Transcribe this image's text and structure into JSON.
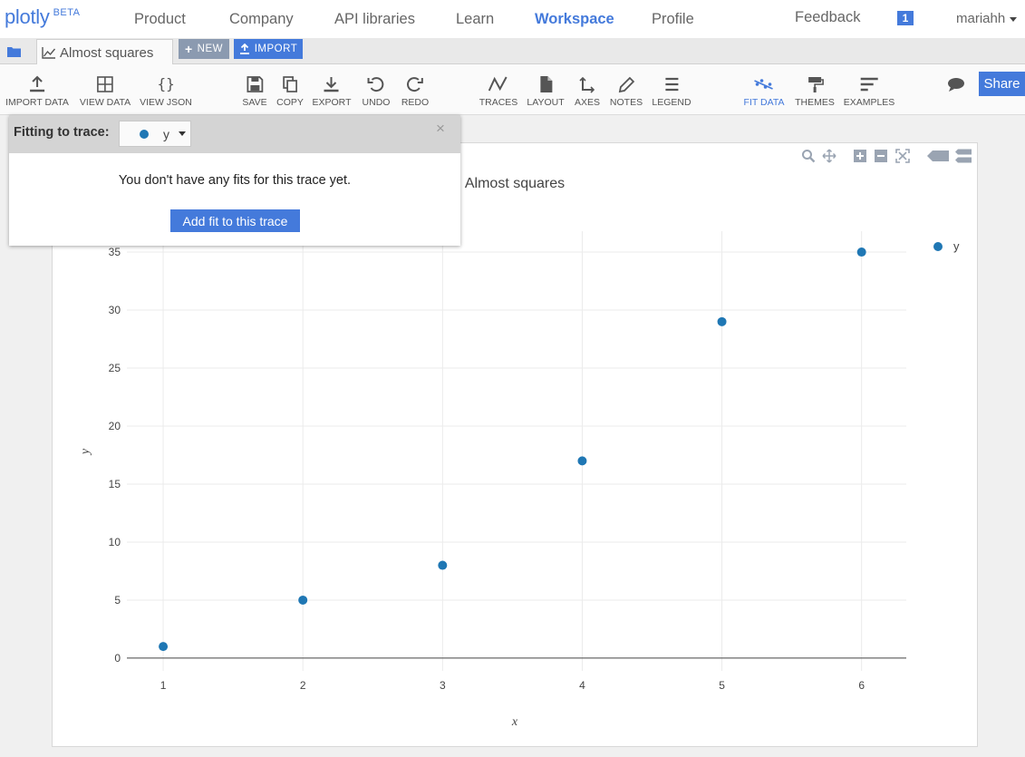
{
  "brand": {
    "name": "plotly",
    "tag": "BETA"
  },
  "nav": {
    "links": [
      "Product",
      "Company",
      "API libraries",
      "Learn",
      "Workspace",
      "Profile"
    ],
    "active": "Workspace",
    "feedback": "Feedback",
    "notification_count": "1",
    "user": "mariahh"
  },
  "tabs": {
    "document_title": "Almost squares",
    "new_label": "NEW",
    "import_label": "IMPORT"
  },
  "toolbar": {
    "import_data": "IMPORT DATA",
    "view_data": "VIEW DATA",
    "view_json": "VIEW JSON",
    "save": "SAVE",
    "copy": "COPY",
    "export": "EXPORT",
    "undo": "UNDO",
    "redo": "REDO",
    "traces": "TRACES",
    "layout": "LAYOUT",
    "axes": "AXES",
    "notes": "NOTES",
    "legend": "LEGEND",
    "fit_data": "FIT DATA",
    "themes": "THEMES",
    "examples": "EXAMPLES",
    "share": "Share"
  },
  "fit_panel": {
    "label": "Fitting to trace:",
    "selected_trace": "y",
    "close": "×",
    "message": "You don't have any fits for this trace yet.",
    "add_button": "Add fit to this trace"
  },
  "colors": {
    "accent": "#447adb",
    "series": "#1f77b4"
  },
  "chart_data": {
    "type": "scatter",
    "title": "Almost squares",
    "xlabel": "x",
    "ylabel": "y",
    "xlim": [
      0.74,
      6.32
    ],
    "ylim": [
      -1.1,
      36.8
    ],
    "x_ticks": [
      1,
      2,
      3,
      4,
      5,
      6
    ],
    "y_ticks": [
      0,
      5,
      10,
      15,
      20,
      25,
      30,
      35
    ],
    "grid": true,
    "legend_position": "top-right",
    "series": [
      {
        "name": "y",
        "color": "#1f77b4",
        "x": [
          1,
          2,
          3,
          4,
          5,
          6
        ],
        "y": [
          1,
          5,
          8,
          17,
          29,
          35
        ]
      }
    ]
  }
}
